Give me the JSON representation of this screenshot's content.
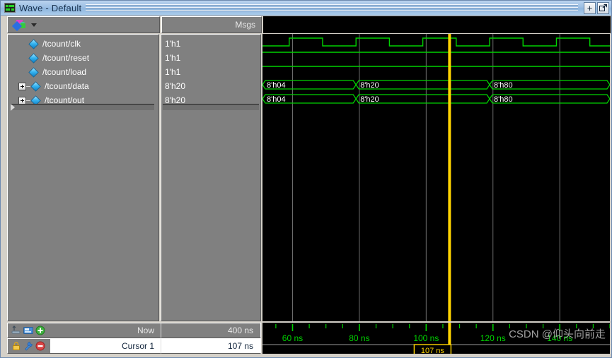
{
  "window": {
    "title": "Wave - Default",
    "icon": "wave-icon",
    "buttons": [
      {
        "name": "add-pane-button",
        "glyph": "+"
      },
      {
        "name": "undock-button",
        "glyph": "undock"
      }
    ]
  },
  "toolbar": {
    "object_icon": "objects-icon",
    "dropdown_icon": "chevron-down-icon"
  },
  "columns": {
    "names_header": "",
    "msgs_header": "Msgs"
  },
  "signals": [
    {
      "name": "/tcount/clk",
      "value": "1'h1",
      "expandable": false,
      "type": "bit"
    },
    {
      "name": "/tcount/reset",
      "value": "1'h1",
      "expandable": false,
      "type": "bit"
    },
    {
      "name": "/tcount/load",
      "value": "1'h1",
      "expandable": false,
      "type": "bit"
    },
    {
      "name": "/tcount/data",
      "value": "8'h20",
      "expandable": true,
      "type": "bus"
    },
    {
      "name": "/tcount/out",
      "value": "8'h20",
      "expandable": true,
      "type": "bus"
    }
  ],
  "status": {
    "now_label": "Now",
    "now_value": "400 ns",
    "cursor_label": "Cursor 1",
    "cursor_value": "107 ns"
  },
  "cursor": {
    "label": "107 ns",
    "time_ns": 107
  },
  "watermark": "CSDN @仰头向前走",
  "colors": {
    "wave_green": "#00d200",
    "cursor_yellow": "#ffd400",
    "background": "#000000",
    "panel_gray": "#808080",
    "title_blue": "#9dc0e4"
  },
  "chart_data": {
    "type": "line",
    "title": "Wave - Default",
    "xlabel": "time",
    "x_unit": "ns",
    "xlim": [
      51,
      155
    ],
    "tick_labels": [
      "60 ns",
      "80 ns",
      "100 ns",
      "120 ns",
      "140 ns"
    ],
    "tick_values": [
      60,
      80,
      100,
      120,
      140
    ],
    "minor_tick_interval": 5,
    "grid": true,
    "gridline_values": [
      60,
      80,
      100,
      120,
      140
    ],
    "cursor_value": 107,
    "series": [
      {
        "name": "/tcount/clk",
        "kind": "digital",
        "value_at_cursor": "1'h1",
        "transitions": [
          {
            "t": 51,
            "v": 0
          },
          {
            "t": 59,
            "v": 1
          },
          {
            "t": 69,
            "v": 0
          },
          {
            "t": 79,
            "v": 1
          },
          {
            "t": 89,
            "v": 0
          },
          {
            "t": 99,
            "v": 1
          },
          {
            "t": 109,
            "v": 0
          },
          {
            "t": 119,
            "v": 1
          },
          {
            "t": 129,
            "v": 0
          },
          {
            "t": 139,
            "v": 1
          },
          {
            "t": 149,
            "v": 0
          }
        ]
      },
      {
        "name": "/tcount/reset",
        "kind": "digital",
        "value_at_cursor": "1'h1",
        "transitions": [
          {
            "t": 51,
            "v": 1
          }
        ]
      },
      {
        "name": "/tcount/load",
        "kind": "digital",
        "value_at_cursor": "1'h1",
        "transitions": [
          {
            "t": 51,
            "v": 1
          }
        ]
      },
      {
        "name": "/tcount/data",
        "kind": "bus",
        "value_at_cursor": "8'h20",
        "segments": [
          {
            "start": 51,
            "end": 79,
            "label": "8'h04"
          },
          {
            "start": 79,
            "end": 119,
            "label": "8'h20"
          },
          {
            "start": 119,
            "end": 155,
            "label": "8'h80"
          }
        ]
      },
      {
        "name": "/tcount/out",
        "kind": "bus",
        "value_at_cursor": "8'h20",
        "segments": [
          {
            "start": 51,
            "end": 79,
            "label": "8'h04"
          },
          {
            "start": 79,
            "end": 119,
            "label": "8'h20"
          },
          {
            "start": 119,
            "end": 155,
            "label": "8'h80"
          }
        ]
      }
    ]
  }
}
